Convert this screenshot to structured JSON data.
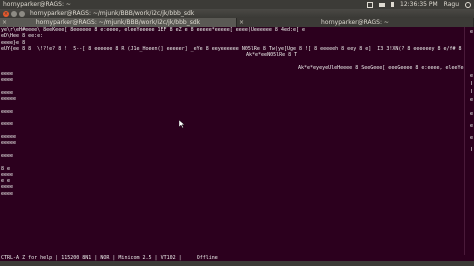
{
  "panel": {
    "app_title": "hornyparker@RAGS: ~",
    "time": "12:36:35 PM",
    "user": "Ragu"
  },
  "window": {
    "title": "hornyparker@RAGS: ~/mjunk/BBB/work/i2c/jk/bbb_sdk"
  },
  "tabs": [
    {
      "label": "hornyparker@RAGS: ~/mjunk/BBB/work/i2c/jk/bbb_sdk"
    },
    {
      "label": "hornyparker@RAGS: ~"
    }
  ],
  "terminal": {
    "lines": [
      "ye\\r\\eH#eeee\\ 8eeKeee[ 8eeeeee 8 e:eeee, eleeYeeeee 1EF 8 eZ e 8 eeeee*eeeee[ eeee(Ueeeeee 8 4ed:e[ e",
      "eD\\Hee 8 ee:e:",
      "eeee}e 8 ",
      "eUY{ee 8 8  \\!?!e? 8 !  5--[ 8 eeeeee 8 R (J1e_Hoeen(] eeeeer] _eYe 8 eeyeeeeee N05lRe 8 Tw(ye[Uge 8 ![ 8 eeeeeh 8 eey 8 e]  I3 3!XN(? 8 eeeeeey 8 e/f# 8 8 eeeeeh e/t",
      "Ak*e*eeN05lRe 8 T",
      "Ak*e*eyeyeUleHeeee 8 SeeGeee[ eeeGeeee 8 e:eeee, eleeYee",
      "eeee",
      "eeee",
      "",
      "eeee",
      "eeeee",
      "",
      "eeee",
      "",
      "eeee",
      "",
      "eeeee",
      "eeeee",
      "",
      "eeee",
      "",
      "8 e",
      "eeee",
      "e e",
      "eeee",
      "eeee"
    ]
  },
  "status": {
    "help": "CTRL-A Z for help",
    "baud": "115200 8N1",
    "mode": "NOR",
    "program": "Minicom 2.5",
    "term": "VT102",
    "state": "Offline"
  }
}
